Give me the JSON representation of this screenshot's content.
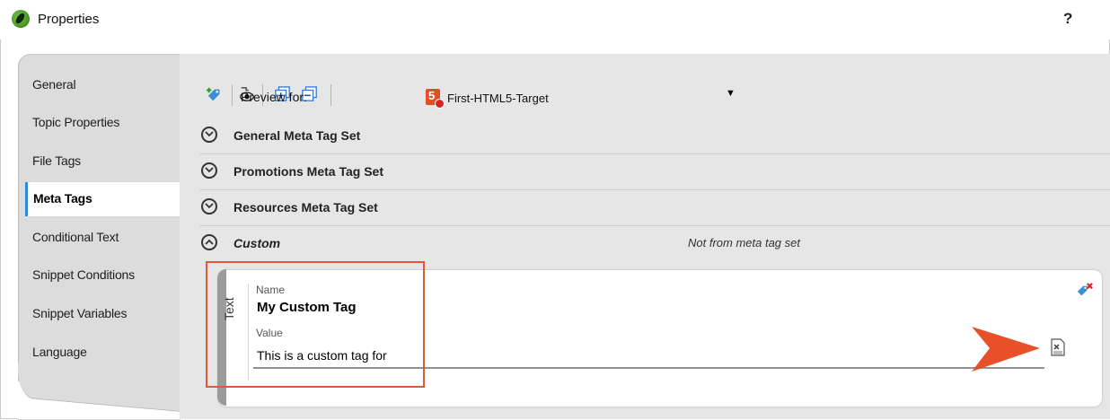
{
  "window": {
    "title": "Properties",
    "help_label": "?"
  },
  "sidebar": {
    "tabs": [
      {
        "label": "General"
      },
      {
        "label": "Topic Properties"
      },
      {
        "label": "File Tags"
      },
      {
        "label": "Meta Tags",
        "active": true
      },
      {
        "label": "Conditional Text"
      },
      {
        "label": "Snippet Conditions"
      },
      {
        "label": "Snippet Variables"
      },
      {
        "label": "Language"
      }
    ]
  },
  "toolbar": {
    "preview_label": "Preview for:",
    "target": "First-HTML5-Target",
    "icons": [
      "add-tag-icon",
      "preview-icon",
      "expand-all-icon",
      "collapse-all-icon"
    ]
  },
  "sections": [
    {
      "label": "General Meta Tag Set",
      "state": "collapsed"
    },
    {
      "label": "Promotions Meta Tag Set",
      "state": "collapsed"
    },
    {
      "label": "Resources Meta Tag Set",
      "state": "collapsed"
    },
    {
      "label": "Custom",
      "state": "expanded",
      "note": "Not from meta tag set"
    }
  ],
  "custom_tag": {
    "type": "Text",
    "name_label": "Name",
    "name_value": "My Custom Tag",
    "value_label": "Value",
    "value_text": "This is a custom tag for"
  },
  "colors": {
    "highlight": "#e05a3a",
    "active_tab_accent": "#2d8ad6",
    "callout_arrow": "#e8502a"
  }
}
